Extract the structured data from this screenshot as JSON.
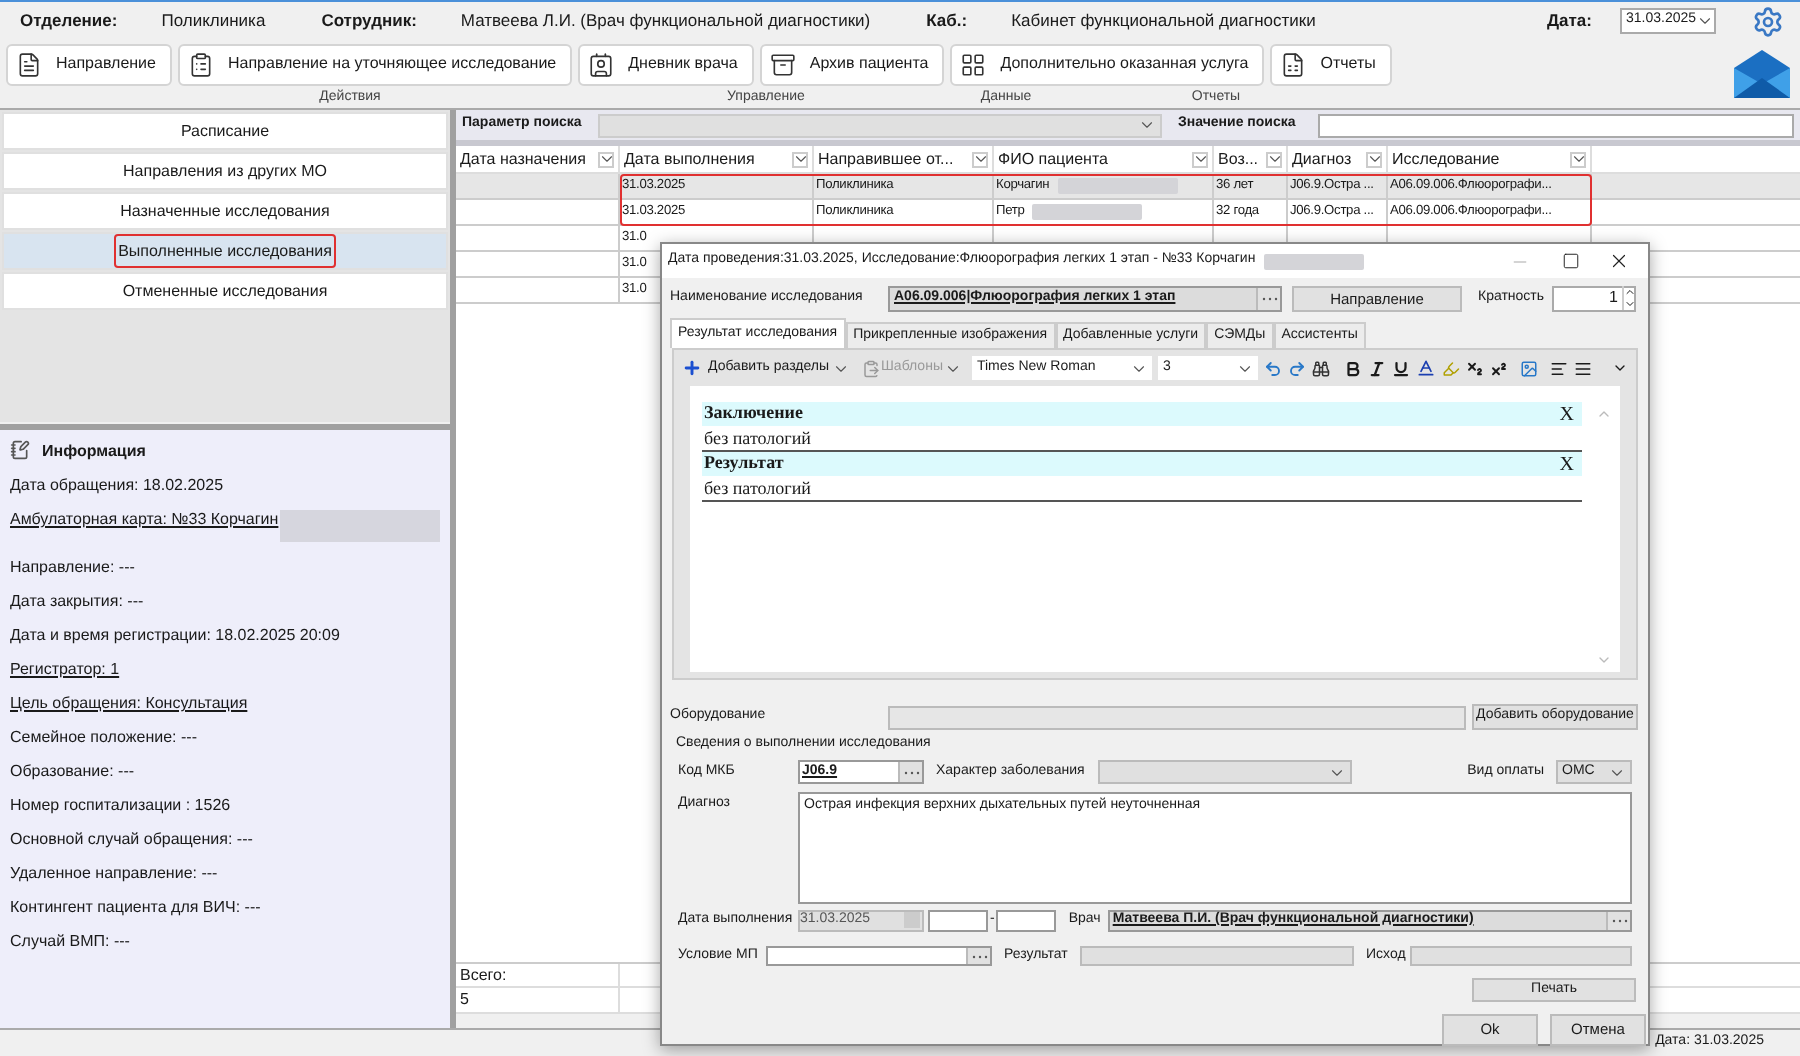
{
  "header": {
    "fields": [
      {
        "label": "Отделение:",
        "value": "Поликлиника"
      },
      {
        "label": "Сотрудник:",
        "value": "Матвеева Л.И. (Врач функциональной диагностики)"
      },
      {
        "label": "Каб.:",
        "value": "Кабинет функциональной диагностики"
      }
    ],
    "date_label": "Дата:",
    "date": "31.03.2025"
  },
  "toolbar": [
    {
      "label": "Направление",
      "kind": "referral"
    },
    {
      "label": "Направление на уточняющее исследование",
      "kind": "clarify"
    },
    {
      "label": "Дневник врача",
      "kind": "diary"
    },
    {
      "label": "Архив пациента",
      "kind": "archive"
    },
    {
      "label": "Дополнительно оказанная услуга",
      "kind": "extra"
    },
    {
      "label": "Отчеты",
      "kind": "reports"
    }
  ],
  "toolbar_groups": [
    "Действия",
    "Управление",
    "Данные",
    "Отчеты"
  ],
  "nav": [
    {
      "label": "Расписание",
      "selected": false,
      "highlighted": false
    },
    {
      "label": "Направления из других МО",
      "selected": false,
      "highlighted": false
    },
    {
      "label": "Назначенные исследования",
      "selected": false,
      "highlighted": false
    },
    {
      "label": "Выполненные исследования",
      "selected": true,
      "highlighted": true
    },
    {
      "label": "Отмененные исследования",
      "selected": false,
      "highlighted": false
    }
  ],
  "info": {
    "title": "Информация",
    "lines": [
      {
        "text": "Дата обращения: 18.02.2025",
        "link": false,
        "redacted": false
      },
      {
        "text": "Амбулаторная карта: №33 Корчагин",
        "link": true,
        "redacted": true
      },
      {
        "text": "Направление: ---",
        "link": false,
        "redacted": false
      },
      {
        "text": "Дата закрытия: ---",
        "link": false,
        "redacted": false
      },
      {
        "text": "Дата и время регистрации: 18.02.2025 20:09",
        "link": false,
        "redacted": false
      },
      {
        "text": "Регистратор: 1",
        "link": true,
        "redacted": false
      },
      {
        "text": "Цель обращения: Консультация",
        "link": true,
        "redacted": false
      },
      {
        "text": "Семейное положение: ---",
        "link": false,
        "redacted": false
      },
      {
        "text": "Образование: ---",
        "link": false,
        "redacted": false
      },
      {
        "text": "Номер госпитализации : 1526",
        "link": false,
        "redacted": false
      },
      {
        "text": "Основной случай обращения: ---",
        "link": false,
        "redacted": false
      },
      {
        "text": "Удаленное направление: ---",
        "link": false,
        "redacted": false
      },
      {
        "text": "Контингент пациента для ВИЧ: ---",
        "link": false,
        "redacted": false
      },
      {
        "text": "Случай ВМП: ---",
        "link": false,
        "redacted": false
      }
    ]
  },
  "search": {
    "param_label": "Параметр поиска",
    "value_label": "Значение поиска"
  },
  "table": {
    "columns": [
      "Дата назначения",
      "Дата выполнения",
      "Направившее  от...",
      "ФИО пациента",
      "Воз...",
      "Диагноз",
      "Исследование"
    ],
    "rows": [
      {
        "cells": [
          null,
          "31.03.2025",
          "Поликлиника",
          "Корчагин",
          "36 лет",
          "J06.9.Остра ...",
          "A06.09.006.Флюорографи..."
        ],
        "selected": true,
        "highlighted": true,
        "redacted": true
      },
      {
        "cells": [
          null,
          "31.03.2025",
          "Поликлиника",
          "Петр",
          "32 года",
          "J06.9.Остра ...",
          "A06.09.006.Флюорографи..."
        ],
        "selected": false,
        "highlighted": true,
        "redacted": true
      },
      {
        "cells": [
          null,
          "31.0"
        ],
        "selected": false,
        "highlighted": false,
        "redacted": false
      },
      {
        "cells": [
          null,
          "31.0"
        ],
        "selected": false,
        "highlighted": false,
        "redacted": false
      },
      {
        "cells": [
          null,
          "31.0"
        ],
        "selected": false,
        "highlighted": false,
        "redacted": false
      }
    ],
    "total_label": "Всего:",
    "total": "5"
  },
  "status_bar": {
    "date": "Дата: 31.03.2025"
  },
  "dialog": {
    "title": "Дата проведения:31.03.2025, Исследование:Флюорография легких 1 этап - №33 Корчагин",
    "title_redacted": true,
    "study_label": "Наименование исследования",
    "study_value": "A06.09.006|Флюорография легких 1 этап",
    "direction_button": "Направление",
    "multiplicity_label": "Кратность",
    "multiplicity": "1",
    "tabs": [
      {
        "label": "Результат исследования",
        "selected": true
      },
      {
        "label": "Прикрепленные изображения",
        "selected": false
      },
      {
        "label": "Добавленные услуги",
        "selected": false
      },
      {
        "label": "СЭМДы",
        "selected": false
      },
      {
        "label": "Ассистенты",
        "selected": false
      }
    ],
    "editor": {
      "add_sections": "Добавить разделы",
      "templates": "Шаблоны",
      "templates_disabled": true,
      "font": "Times New Roman",
      "size": "3",
      "sections": [
        {
          "title": "Заключение",
          "text": "без патологий",
          "remove": "X"
        },
        {
          "title": "Результат",
          "text": "без патологий",
          "remove": "X"
        }
      ]
    },
    "equipment_label": "Оборудование",
    "add_equipment": "Добавить оборудование",
    "group_title": "Сведения о выполнении исследования",
    "mkb_label": "Код МКБ",
    "mkb": "J06.9",
    "nature_label": "Характер заболевания",
    "payment_label": "Вид оплаты",
    "payment": "ОМС",
    "diagnosis_label": "Диагноз",
    "diagnosis": "Острая инфекция верхних дыхательных путей неуточненная",
    "date_label": "Дата выполнения",
    "date": "31.03.2025",
    "time_separator": "-",
    "doctor_label": "Врач",
    "doctor": "Матвеева П.И. (Врач функциональной диагностики)",
    "condition_label": "Условие МП",
    "result_label": "Результат",
    "outcome_label": "Исход",
    "print": "Печать",
    "ok": "Ok",
    "cancel": "Отмена"
  }
}
